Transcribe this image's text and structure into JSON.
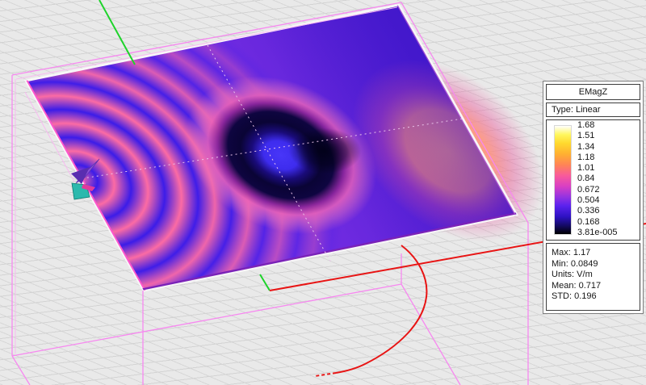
{
  "legend": {
    "title": "EMagZ",
    "type_label": "Type: Linear",
    "scale_values": [
      "1.68",
      "1.51",
      "1.34",
      "1.18",
      "1.01",
      "0.84",
      "0.672",
      "0.504",
      "0.336",
      "0.168",
      "3.81e-005"
    ],
    "stats": [
      "Max: 1.17",
      "Min: 0.0849",
      "Units: V/m",
      "Mean: 0.717",
      "STD: 0.196"
    ]
  },
  "colors": {
    "viewport_background": "#e9e9e9",
    "grid_line": "#d3d3d3",
    "wireframe_box": "#f788f0",
    "axis_x_red": "#e81414",
    "axis_y_green": "#1ed32b",
    "field_pink": "#fb6ba4",
    "field_blue": "#3c1ce8",
    "field_salmon": "#ff9a76",
    "field_null_core": "#4836f8",
    "field_null_ring": "#0a0435",
    "colorbar_top": "#ffffff",
    "colorbar_bottom": "#000000"
  }
}
